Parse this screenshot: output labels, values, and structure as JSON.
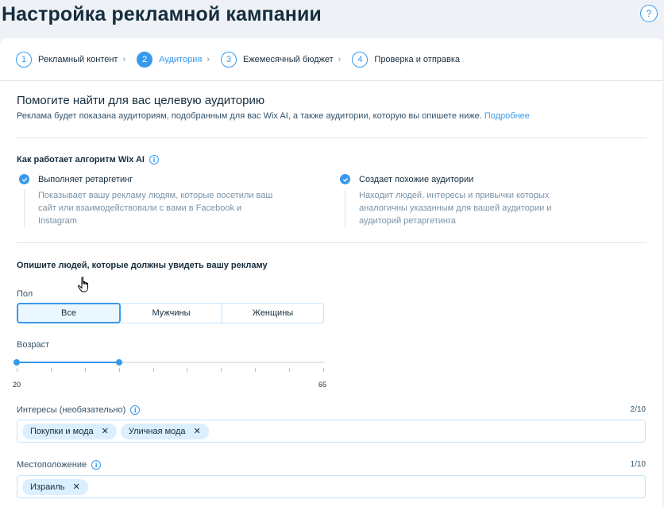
{
  "page": {
    "title": "Настройка рекламной кампании",
    "help_icon": "question-icon"
  },
  "stepper": {
    "steps": [
      {
        "num": "1",
        "label": "Рекламный контент"
      },
      {
        "num": "2",
        "label": "Аудитория"
      },
      {
        "num": "3",
        "label": "Ежемесячный бюджет"
      },
      {
        "num": "4",
        "label": "Проверка и отправка"
      }
    ],
    "active_index": 1
  },
  "audience": {
    "title": "Помогите найти для вас целевую аудиторию",
    "description": "Реклама будет показана аудиториям, подобранным для вас Wix AI, а также аудитории, которую вы опишете ниже.",
    "learn_more": "Подробнее"
  },
  "algorithm": {
    "title": "Как работает алгоритм Wix AI",
    "features": [
      {
        "title": "Выполняет ретаргетинг",
        "body": "Показывает вашу рекламу людям, которые посетили ваш сайт или взаимодействовали с вами в Facebook и Instagram"
      },
      {
        "title": "Создает похожие аудитории",
        "body": "Находит людей, интересы и привычки которых аналогичны указанным для вашей аудитории и аудиторий ретаргетинга"
      }
    ]
  },
  "describe": {
    "title": "Опишите людей, которые должны увидеть вашу рекламу"
  },
  "gender": {
    "label": "Пол",
    "options": [
      "Все",
      "Мужчины",
      "Женщины"
    ],
    "selected": "Все"
  },
  "age": {
    "label": "Возраст",
    "min_label": "20",
    "max_label": "65",
    "min": 20,
    "max": 65,
    "value_low": 20,
    "value_high": 35,
    "tick_count": 10
  },
  "interests": {
    "label": "Интересы (необязательно)",
    "counter": "2/10",
    "tags": [
      "Покупки и мода",
      "Уличная мода"
    ]
  },
  "location": {
    "label": "Местоположение",
    "counter": "1/10",
    "tags": [
      "Израиль"
    ]
  },
  "colors": {
    "accent": "#3899ec",
    "text": "#162d3d",
    "muted": "#7a92a5",
    "tag_bg": "#dcefff"
  }
}
